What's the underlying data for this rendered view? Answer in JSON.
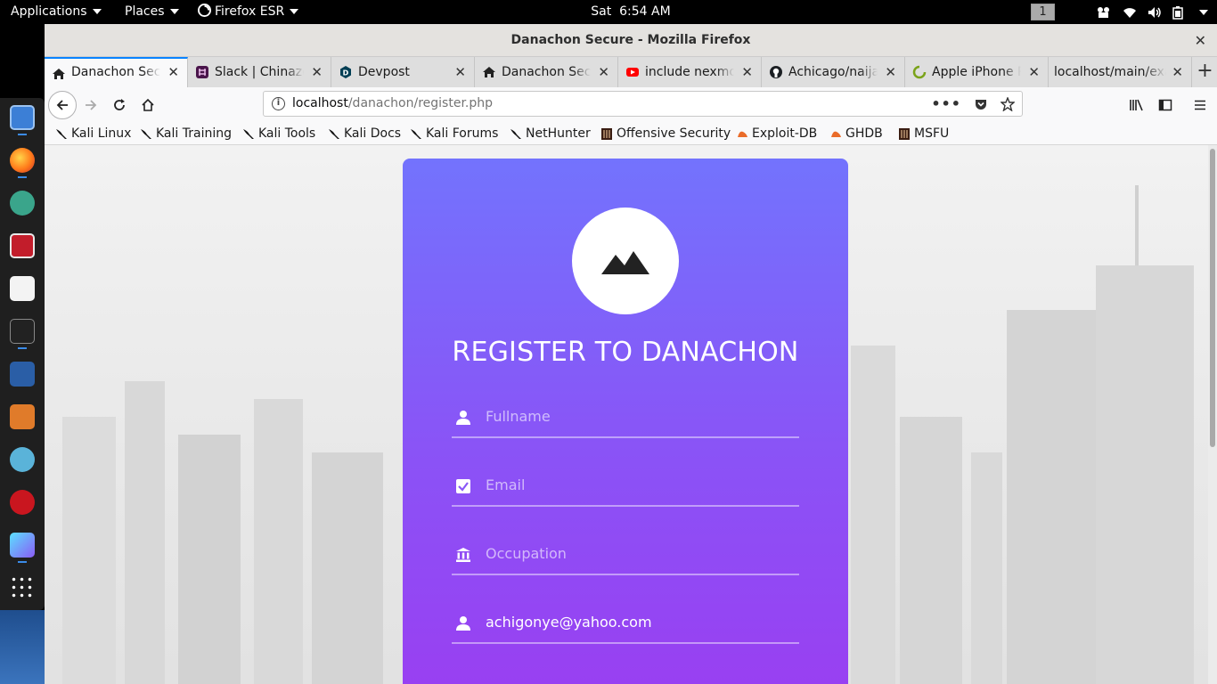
{
  "topbar": {
    "applications": "Applications",
    "places": "Places",
    "firefox": "Firefox ESR",
    "clock": "Sat  6:54 AM",
    "workspace": "1"
  },
  "window": {
    "title": "Danachon Secure - Mozilla Firefox"
  },
  "tabs": [
    {
      "label": "Danachon Secure",
      "icon": "home-icon"
    },
    {
      "label": "Slack | Chinazo",
      "icon": "slack-icon"
    },
    {
      "label": "Devpost",
      "icon": "devpost-icon"
    },
    {
      "label": "Danachon Secure",
      "icon": "home-icon"
    },
    {
      "label": "include nexmo",
      "icon": "youtube-icon"
    },
    {
      "label": "Achicago/naija",
      "icon": "github-icon"
    },
    {
      "label": "Apple iPhone R",
      "icon": "loading-icon"
    },
    {
      "label": "localhost/main/exa",
      "icon": ""
    }
  ],
  "url": {
    "host": "localhost",
    "path": "/danachon/register.php"
  },
  "bookmarks": [
    {
      "label": "Kali Linux",
      "icon": "kali-dragon-icon"
    },
    {
      "label": "Kali Training",
      "icon": "kali-dragon-icon"
    },
    {
      "label": "Kali Tools",
      "icon": "kali-dragon-icon"
    },
    {
      "label": "Kali Docs",
      "icon": "kali-dragon-icon"
    },
    {
      "label": "Kali Forums",
      "icon": "kali-dragon-icon"
    },
    {
      "label": "NetHunter",
      "icon": "kali-dragon-icon"
    },
    {
      "label": "Offensive Security",
      "icon": "offsec-icon"
    },
    {
      "label": "Exploit-DB",
      "icon": "exploitdb-icon"
    },
    {
      "label": "GHDB",
      "icon": "exploitdb-icon"
    },
    {
      "label": "MSFU",
      "icon": "offsec-icon"
    }
  ],
  "page": {
    "title": "REGISTER TO DANACHON",
    "fields": [
      {
        "placeholder": "Fullname",
        "value": "",
        "icon": "person-icon"
      },
      {
        "placeholder": "Email",
        "value": "",
        "icon": "checkbox-icon"
      },
      {
        "placeholder": "Occupation",
        "value": "",
        "icon": "bank-icon"
      },
      {
        "placeholder": "",
        "value": "achigonye@yahoo.com",
        "icon": "person-icon"
      }
    ]
  },
  "colors": {
    "card_top": "#7373fd",
    "card_bottom": "#9a3ef1",
    "tab_accent": "#0a84ff"
  }
}
